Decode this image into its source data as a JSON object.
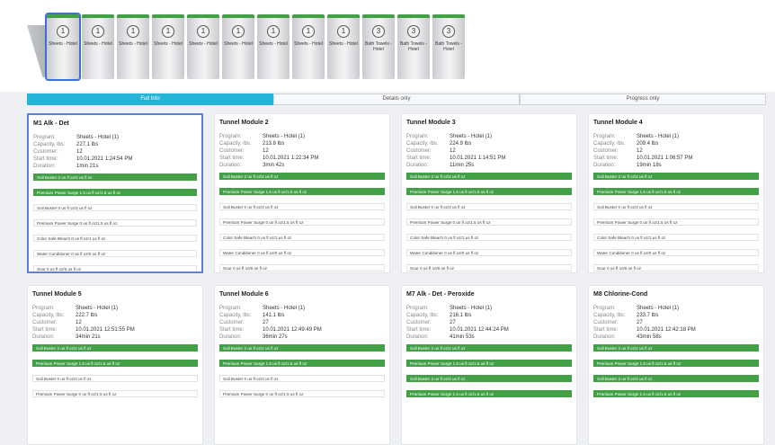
{
  "modules": [
    {
      "number": "1",
      "label": "Sheets - Hotel",
      "selected": true
    },
    {
      "number": "1",
      "label": "Sheets - Hotel"
    },
    {
      "number": "1",
      "label": "Sheets - Hotel"
    },
    {
      "number": "1",
      "label": "Sheets - Hotel"
    },
    {
      "number": "1",
      "label": "Sheets - Hotel"
    },
    {
      "number": "1",
      "label": "Sheets - Hotel"
    },
    {
      "number": "1",
      "label": "Sheets - Hotel"
    },
    {
      "number": "1",
      "label": "Sheets - Hotel"
    },
    {
      "number": "1",
      "label": "Sheets - Hotel"
    },
    {
      "number": "3",
      "label": "Bath Towels - Hotel"
    },
    {
      "number": "3",
      "label": "Bath Towels - Hotel"
    },
    {
      "number": "3",
      "label": "Bath Towels - Hotel"
    }
  ],
  "tabs": [
    "Full Info",
    "Details only",
    "Progress only"
  ],
  "field_labels": {
    "program": "Program:",
    "capacity": "Capacity, lbs:",
    "customer": "Customer:",
    "start": "Start time:",
    "duration": "Duration:"
  },
  "cards": [
    {
      "title": "M1 Alk - Det",
      "program": "Sheets - Hotel (1)",
      "capacity": "227.1 lbs",
      "customer": "12",
      "start": "10.01.2021 1:24:54 PM",
      "duration": "1min 21s",
      "chems": [
        "Soil Buster 2 us fl oz/2 us fl oz",
        "Premium Power Surge 1.5 us fl oz/1.5 us fl oz",
        "Soil Buster 0 us fl oz/3 us fl oz",
        "Premium Power Surge 0 us fl oz/1.5 us fl oz",
        "Color Safe Bleach 0 us fl oz/1 us fl oz",
        "Water Conditioner 0 us fl oz/0 us fl oz",
        "Sour 0 us fl oz/6 us fl oz"
      ],
      "green": 2
    },
    {
      "title": "Tunnel Module 2",
      "program": "Sheets - Hotel (1)",
      "capacity": "213.8 lbs",
      "customer": "12",
      "start": "10.01.2021 1:22:34 PM",
      "duration": "3min 42s",
      "chems": [
        "Soil Buster 2 us fl oz/2 us fl oz",
        "Premium Power Surge 1.5 us fl oz/1.5 us fl oz",
        "Soil Buster 0 us fl oz/3 us fl oz",
        "Premium Power Surge 0 us fl oz/1.5 us fl oz",
        "Color Safe Bleach 0 us fl oz/1 us fl oz",
        "Water Conditioner 0 us fl oz/0 us fl oz",
        "Sour 0 us fl oz/6 us fl oz"
      ],
      "green": 2
    },
    {
      "title": "Tunnel Module 3",
      "program": "Sheets - Hotel (1)",
      "capacity": "224.9 lbs",
      "customer": "12",
      "start": "10.01.2021 1:14:51 PM",
      "duration": "11min 25s",
      "chems": [
        "Soil Buster 2 us fl oz/2 us fl oz",
        "Premium Power Surge 1.5 us fl oz/1.5 us fl oz",
        "Soil Buster 0 us fl oz/3 us fl oz",
        "Premium Power Surge 0 us fl oz/1.5 us fl oz",
        "Color Safe Bleach 0 us fl oz/1 us fl oz",
        "Water Conditioner 0 us fl oz/0 us fl oz",
        "Sour 0 us fl oz/6 us fl oz"
      ],
      "green": 2
    },
    {
      "title": "Tunnel Module 4",
      "program": "Sheets - Hotel (1)",
      "capacity": "209.4 lbs",
      "customer": "12",
      "start": "10.01.2021 1:06:57 PM",
      "duration": "19min 18s",
      "chems": [
        "Soil Buster 2 us fl oz/2 us fl oz",
        "Premium Power Surge 1.5 us fl oz/1.5 us fl oz",
        "Soil Buster 0 us fl oz/3 us fl oz",
        "Premium Power Surge 0 us fl oz/1.5 us fl oz",
        "Color Safe Bleach 0 us fl oz/1 us fl oz",
        "Water Conditioner 0 us fl oz/0 us fl oz",
        "Sour 0 us fl oz/6 us fl oz"
      ],
      "green": 2
    },
    {
      "title": "Tunnel Module 5",
      "program": "Sheets - Hotel (1)",
      "capacity": "222.7 lbs",
      "customer": "12",
      "start": "10.01.2021 12:51:55 PM",
      "duration": "34min 21s",
      "chems": [
        "Soil Buster 2 us fl oz/2 us fl oz",
        "Premium Power Surge 1.5 us fl oz/1.5 us fl oz",
        "Soil Buster 0 us fl oz/3 us fl oz",
        "Premium Power Surge 0 us fl oz/1.5 us fl oz"
      ],
      "green": 2
    },
    {
      "title": "Tunnel Module 6",
      "program": "Sheets - Hotel (1)",
      "capacity": "141.1 lbs",
      "customer": "27",
      "start": "10.01.2021 12:49:49 PM",
      "duration": "36min 27s",
      "chems": [
        "Soil Buster 2 us fl oz/2 us fl oz",
        "Premium Power Surge 1.5 us fl oz/1.5 us fl oz",
        "Soil Buster 0 us fl oz/3 us fl oz",
        "Premium Power Surge 0 us fl oz/1.5 us fl oz"
      ],
      "green": 2
    },
    {
      "title": "M7 Alk - Det - Peroxide",
      "program": "Sheets - Hotel (1)",
      "capacity": "216.1 lbs",
      "customer": "27",
      "start": "10.01.2021 12:44:24 PM",
      "duration": "41min 53s",
      "chems": [
        "Soil Buster 2 us fl oz/2 us fl oz",
        "Premium Power Surge 1.5 us fl oz/1.5 us fl oz",
        "Soil Buster 3 us fl oz/3 us fl oz",
        "Premium Power Surge 1.5 us fl oz/1.5 us fl oz"
      ],
      "green": 4
    },
    {
      "title": "M8 Chlorine-Cond",
      "program": "Sheets - Hotel (1)",
      "capacity": "233.7 lbs",
      "customer": "27",
      "start": "10.01.2021 12:42:18 PM",
      "duration": "43min 58s",
      "chems": [
        "Soil Buster 2 us fl oz/2 us fl oz",
        "Premium Power Surge 1.5 us fl oz/1.5 us fl oz",
        "Soil Buster 3 us fl oz/3 us fl oz",
        "Premium Power Surge 1.5 us fl oz/1.5 us fl oz"
      ],
      "green": 4
    }
  ]
}
